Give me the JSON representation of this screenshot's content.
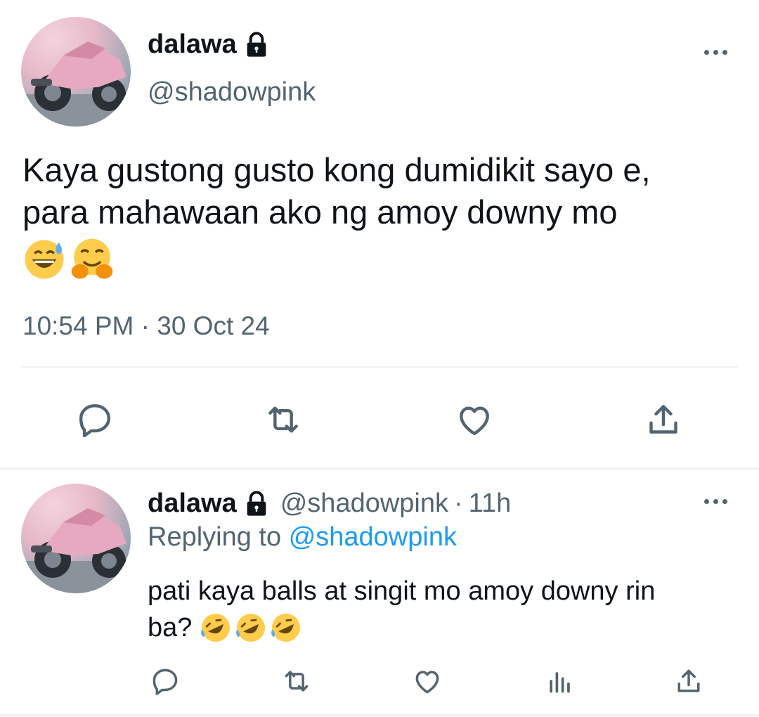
{
  "main_tweet": {
    "author_name": "dalawa",
    "author_handle": "@shadowpink",
    "text_line1": "Kaya gustong gusto kong dumidikit sayo e,",
    "text_line2": "para mahawaan ako ng amoy downy mo",
    "emojis": [
      "grinning-sweat-emoji",
      "hugging-face-emoji"
    ],
    "timestamp": "10:54 PM · 30 Oct 24",
    "actions": [
      "reply-icon",
      "retweet-icon",
      "like-icon",
      "share-icon"
    ]
  },
  "reply_tweet": {
    "author_name": "dalawa",
    "author_handle": "@shadowpink",
    "separator": "·",
    "time_ago": "11h",
    "replying_to_label": "Replying to",
    "replying_to_handle": "@shadowpink",
    "text_line1": "pati kaya balls at singit mo amoy downy rin",
    "text_line2": "ba?",
    "emojis": [
      "rofl-emoji",
      "rofl-emoji",
      "rofl-emoji"
    ],
    "actions": [
      "reply-icon",
      "retweet-icon",
      "like-icon",
      "analytics-icon",
      "share-icon"
    ]
  },
  "colors": {
    "text": "#0f1419",
    "secondary": "#536471",
    "link": "#1d9bf0",
    "divider": "#eff3f4"
  }
}
